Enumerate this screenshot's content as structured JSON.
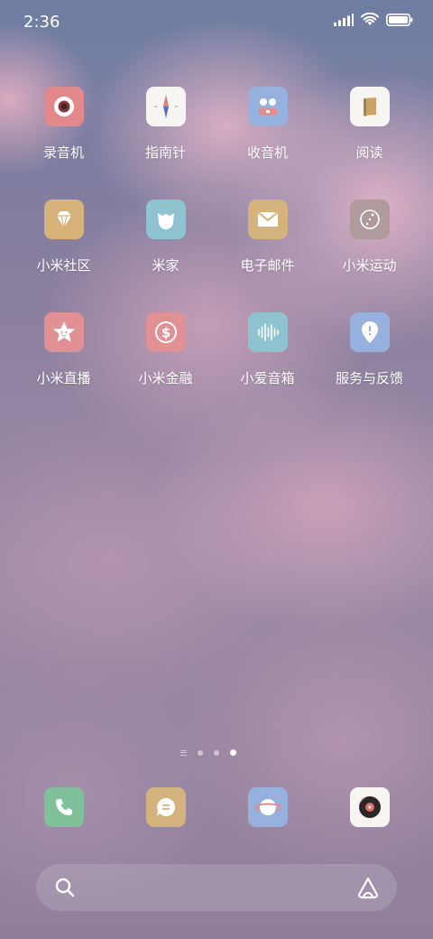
{
  "status_bar": {
    "time": "2:36",
    "icons": [
      "signal-icon",
      "wifi-icon",
      "battery-icon"
    ]
  },
  "apps": [
    {
      "label": "录音机",
      "icon": "recorder-icon",
      "color": "#e3898c"
    },
    {
      "label": "指南针",
      "icon": "compass-icon",
      "color": "#f6f5f2"
    },
    {
      "label": "收音机",
      "icon": "radio-icon",
      "color": "#96b1dd"
    },
    {
      "label": "阅读",
      "icon": "book-icon",
      "color": "#f6f5f2"
    },
    {
      "label": "小米社区",
      "icon": "diamond-icon",
      "color": "#d7b27b"
    },
    {
      "label": "米家",
      "icon": "mijia-icon",
      "color": "#8fc3cf"
    },
    {
      "label": "电子邮件",
      "icon": "mail-icon",
      "color": "#d5b37d"
    },
    {
      "label": "小米运动",
      "icon": "fitness-icon",
      "color": "#b19a9c"
    },
    {
      "label": "小米直播",
      "icon": "star-face-icon",
      "color": "#e19093"
    },
    {
      "label": "小米金融",
      "icon": "dollar-icon",
      "color": "#e19093"
    },
    {
      "label": "小爱音箱",
      "icon": "soundwave-icon",
      "color": "#8fc3cf"
    },
    {
      "label": "服务与反馈",
      "icon": "feedback-pin-icon",
      "color": "#96b1dd"
    }
  ],
  "page_indicator": {
    "pages": 3,
    "active_page": 3
  },
  "dock": [
    {
      "icon": "phone-icon",
      "color": "#7fc29a"
    },
    {
      "icon": "message-icon",
      "color": "#d5b37d"
    },
    {
      "icon": "browser-planet-icon",
      "color": "#96b1dd"
    },
    {
      "icon": "music-disc-icon",
      "color": "#f6f5f2"
    }
  ],
  "search_bar": {
    "left_icon": "search-icon",
    "right_icon": "xiaoai-assistant-icon"
  }
}
